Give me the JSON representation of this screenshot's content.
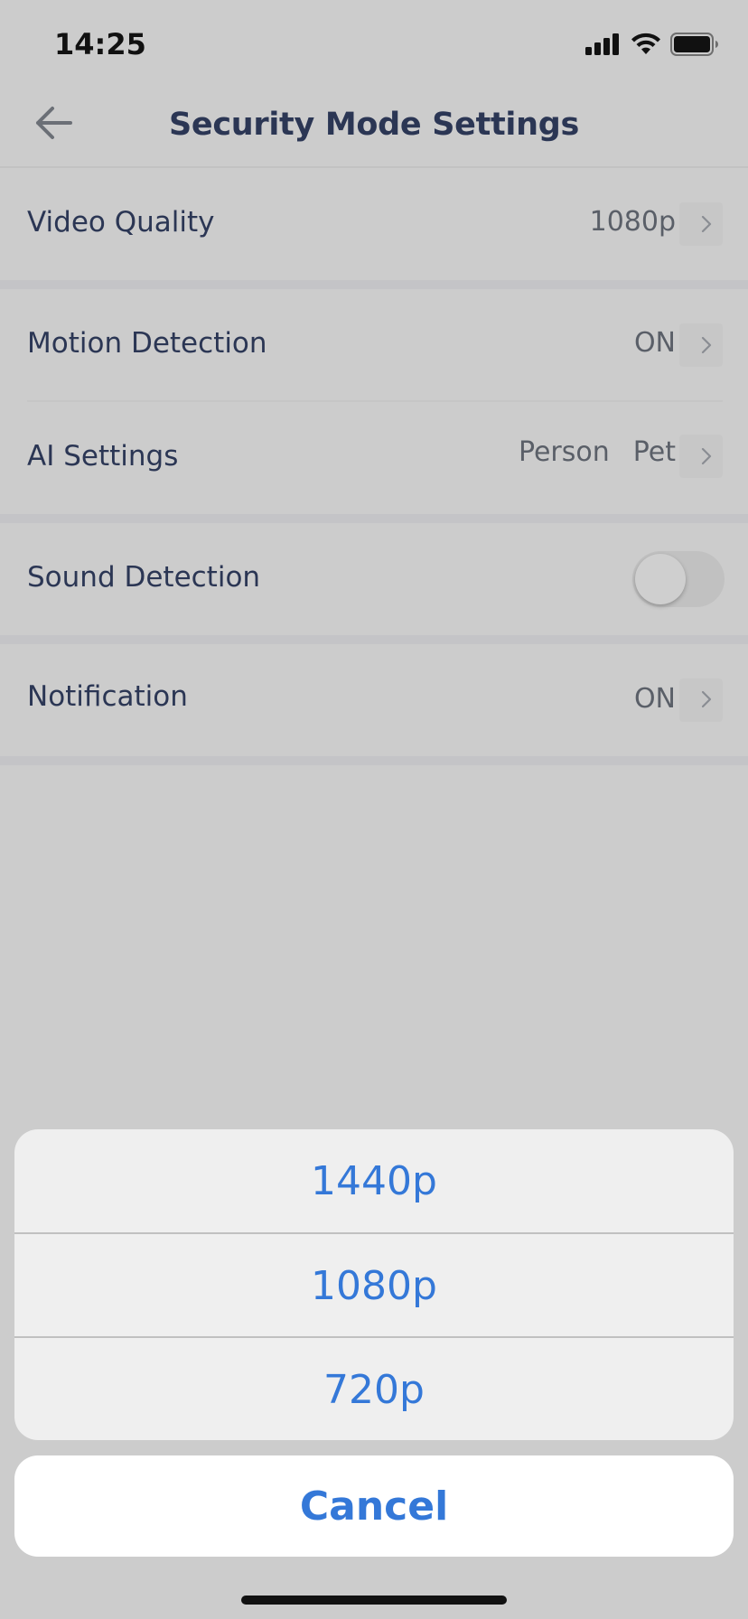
{
  "status_bar": {
    "time": "14:25"
  },
  "header": {
    "title": "Security Mode Settings"
  },
  "settings": {
    "video_quality": {
      "label": "Video Quality",
      "value": "1080p"
    },
    "motion_detection": {
      "label": "Motion Detection",
      "value": "ON"
    },
    "ai_settings": {
      "label": "AI Settings",
      "value_1": "Person",
      "value_2": "Pet"
    },
    "sound_detection": {
      "label": "Sound Detection",
      "enabled": false
    },
    "notification": {
      "label": "Notification",
      "value": "ON"
    }
  },
  "action_sheet": {
    "options": [
      "1440p",
      "1080p",
      "720p"
    ],
    "cancel_label": "Cancel"
  },
  "colors": {
    "accent": "#3478d8",
    "text": "#2b3654",
    "overlay": "#cccccc"
  }
}
